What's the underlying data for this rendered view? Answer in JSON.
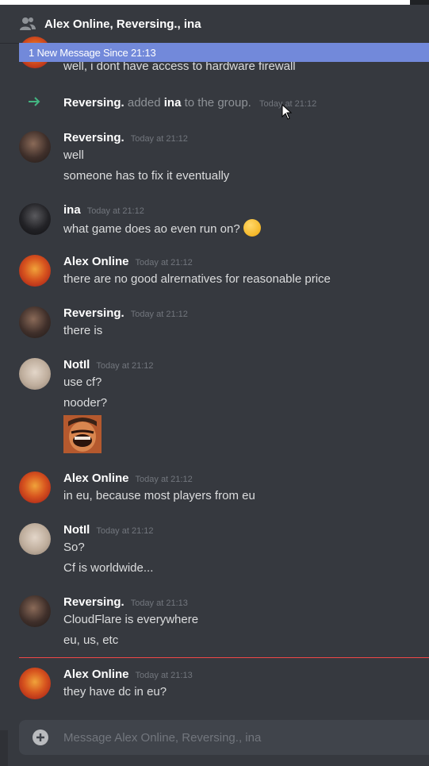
{
  "window": {
    "title": "Alex Online, Reversing., ina"
  },
  "banner": {
    "text": "1 New Message Since 21:13"
  },
  "system_event": {
    "actor": "Reversing.",
    "action": "added",
    "target": "ina",
    "suffix": "to the group.",
    "time": "Today at 21:12"
  },
  "messages": [
    {
      "author": "Alex Online",
      "time": "",
      "lines": [
        "well, i dont have access to hardware firewall"
      ]
    },
    {
      "author": "Reversing.",
      "time": "Today at 21:12",
      "lines": [
        "well",
        "someone has to fix it eventually"
      ]
    },
    {
      "author": "ina",
      "time": "Today at 21:12",
      "lines": [
        "what game does ao even run on?"
      ],
      "emoji": "thinking-face"
    },
    {
      "author": "Alex Online",
      "time": "Today at 21:12",
      "lines": [
        "there are no good alrernatives for reasonable price"
      ]
    },
    {
      "author": "Reversing.",
      "time": "Today at 21:12",
      "lines": [
        "there is"
      ]
    },
    {
      "author": "NotIl",
      "time": "Today at 21:12",
      "lines": [
        "use cf?",
        "nooder?"
      ],
      "attachment": "laughing-man-image"
    },
    {
      "author": "Alex Online",
      "time": "Today at 21:12",
      "lines": [
        "in eu, because most players from eu"
      ]
    },
    {
      "author": "NotIl",
      "time": "Today at 21:12",
      "lines": [
        "So?",
        "Cf is worldwide..."
      ]
    },
    {
      "author": "Reversing.",
      "time": "Today at 21:13",
      "lines": [
        "CloudFlare is everywhere",
        "eu, us, etc"
      ]
    },
    {
      "author": "Alex Online",
      "time": "Today at 21:13",
      "lines": [
        "they have dc in eu?"
      ]
    }
  ],
  "composer": {
    "placeholder": "Message Alex Online, Reversing., ina"
  },
  "colors": {
    "background": "#36393f",
    "banner": "#7289da",
    "new_divider": "#f04747",
    "join_arrow": "#43b581"
  }
}
